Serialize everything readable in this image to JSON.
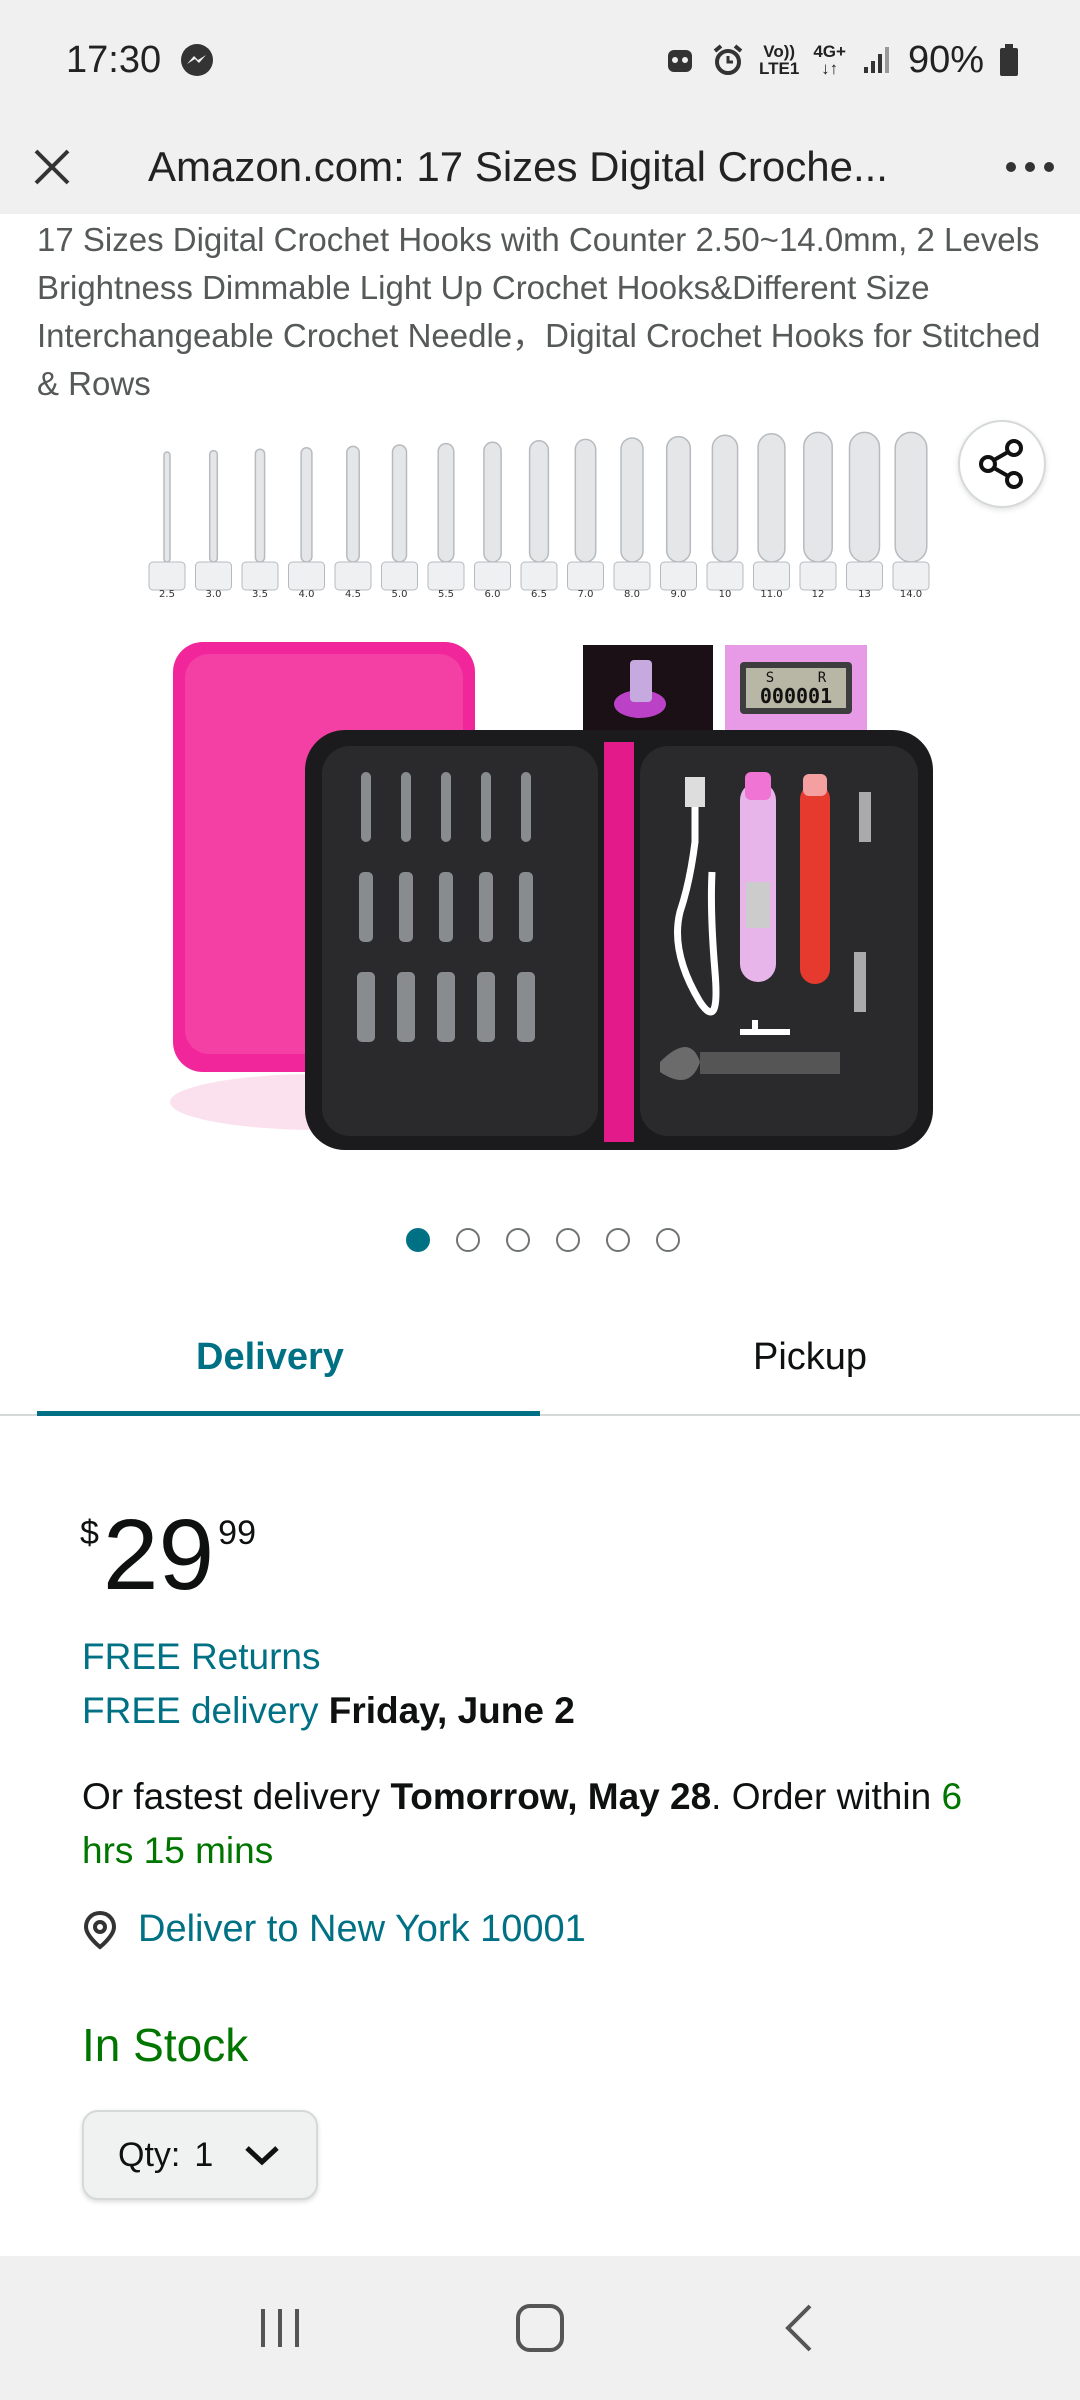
{
  "status_bar": {
    "time": "17:30",
    "network_top": "Vo))",
    "network_bottom": "LTE1",
    "network_type": "4G+",
    "battery": "90%"
  },
  "browser": {
    "title": "Amazon.com: 17 Sizes Digital Croche..."
  },
  "product": {
    "title": "17 Sizes Digital Crochet Hooks with Counter 2.50~14.0mm, 2 Levels Brightness Dimmable Light Up Crochet Hooks&Different Size Interchangeable Crochet Needle，Digital Crochet Hooks for Stitched & Rows",
    "hook_sizes": [
      "2.5",
      "3.0",
      "3.5",
      "4.0",
      "4.5",
      "5.0",
      "5.5",
      "6.0",
      "6.5",
      "7.0",
      "8.0",
      "9.0",
      "10",
      "11.0",
      "12",
      "13",
      "14.0"
    ],
    "counter_labels": [
      "S",
      "R"
    ],
    "counter_value": "000001",
    "image_count": 6,
    "active_image": 1
  },
  "tabs": [
    "Delivery",
    "Pickup"
  ],
  "price": {
    "symbol": "$",
    "whole": "29",
    "fraction": "99"
  },
  "delivery": {
    "free_returns": "FREE Returns",
    "free_delivery": "FREE delivery",
    "free_delivery_date": "Friday, June 2",
    "fastest_prefix": "Or fastest delivery",
    "fastest_date": "Tomorrow, May 28",
    "order_within_prefix": ". Order within",
    "order_within_time": "6 hrs 15 mins",
    "deliver_to": "Deliver to New York 10001"
  },
  "stock": "In Stock",
  "qty": {
    "label": "Qty:",
    "value": "1"
  },
  "colors": {
    "teal": "#007185",
    "green": "#007600",
    "case_pink": "#f0269a",
    "case_dark": "#1b1b1d"
  }
}
